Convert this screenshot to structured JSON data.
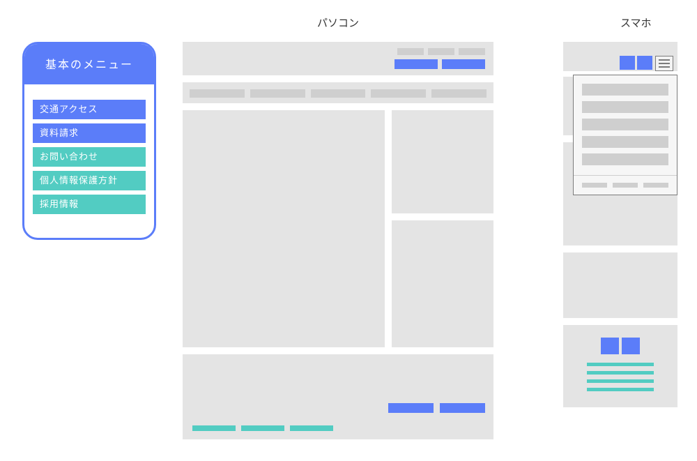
{
  "columns": {
    "pc": "パソコン",
    "sp": "スマホ"
  },
  "sidebar": {
    "title": "基本のメニュー",
    "items": [
      {
        "label": "交通アクセス",
        "variant": "blue"
      },
      {
        "label": "資料請求",
        "variant": "blue"
      },
      {
        "label": "お問い合わせ",
        "variant": "teal"
      },
      {
        "label": "個人情報保護方針",
        "variant": "teal"
      },
      {
        "label": "採用情報",
        "variant": "teal"
      }
    ]
  },
  "colors": {
    "primary": "#5b7df9",
    "accent": "#52ccc2",
    "block": "#e4e4e4",
    "chip": "#cfcfcf"
  }
}
